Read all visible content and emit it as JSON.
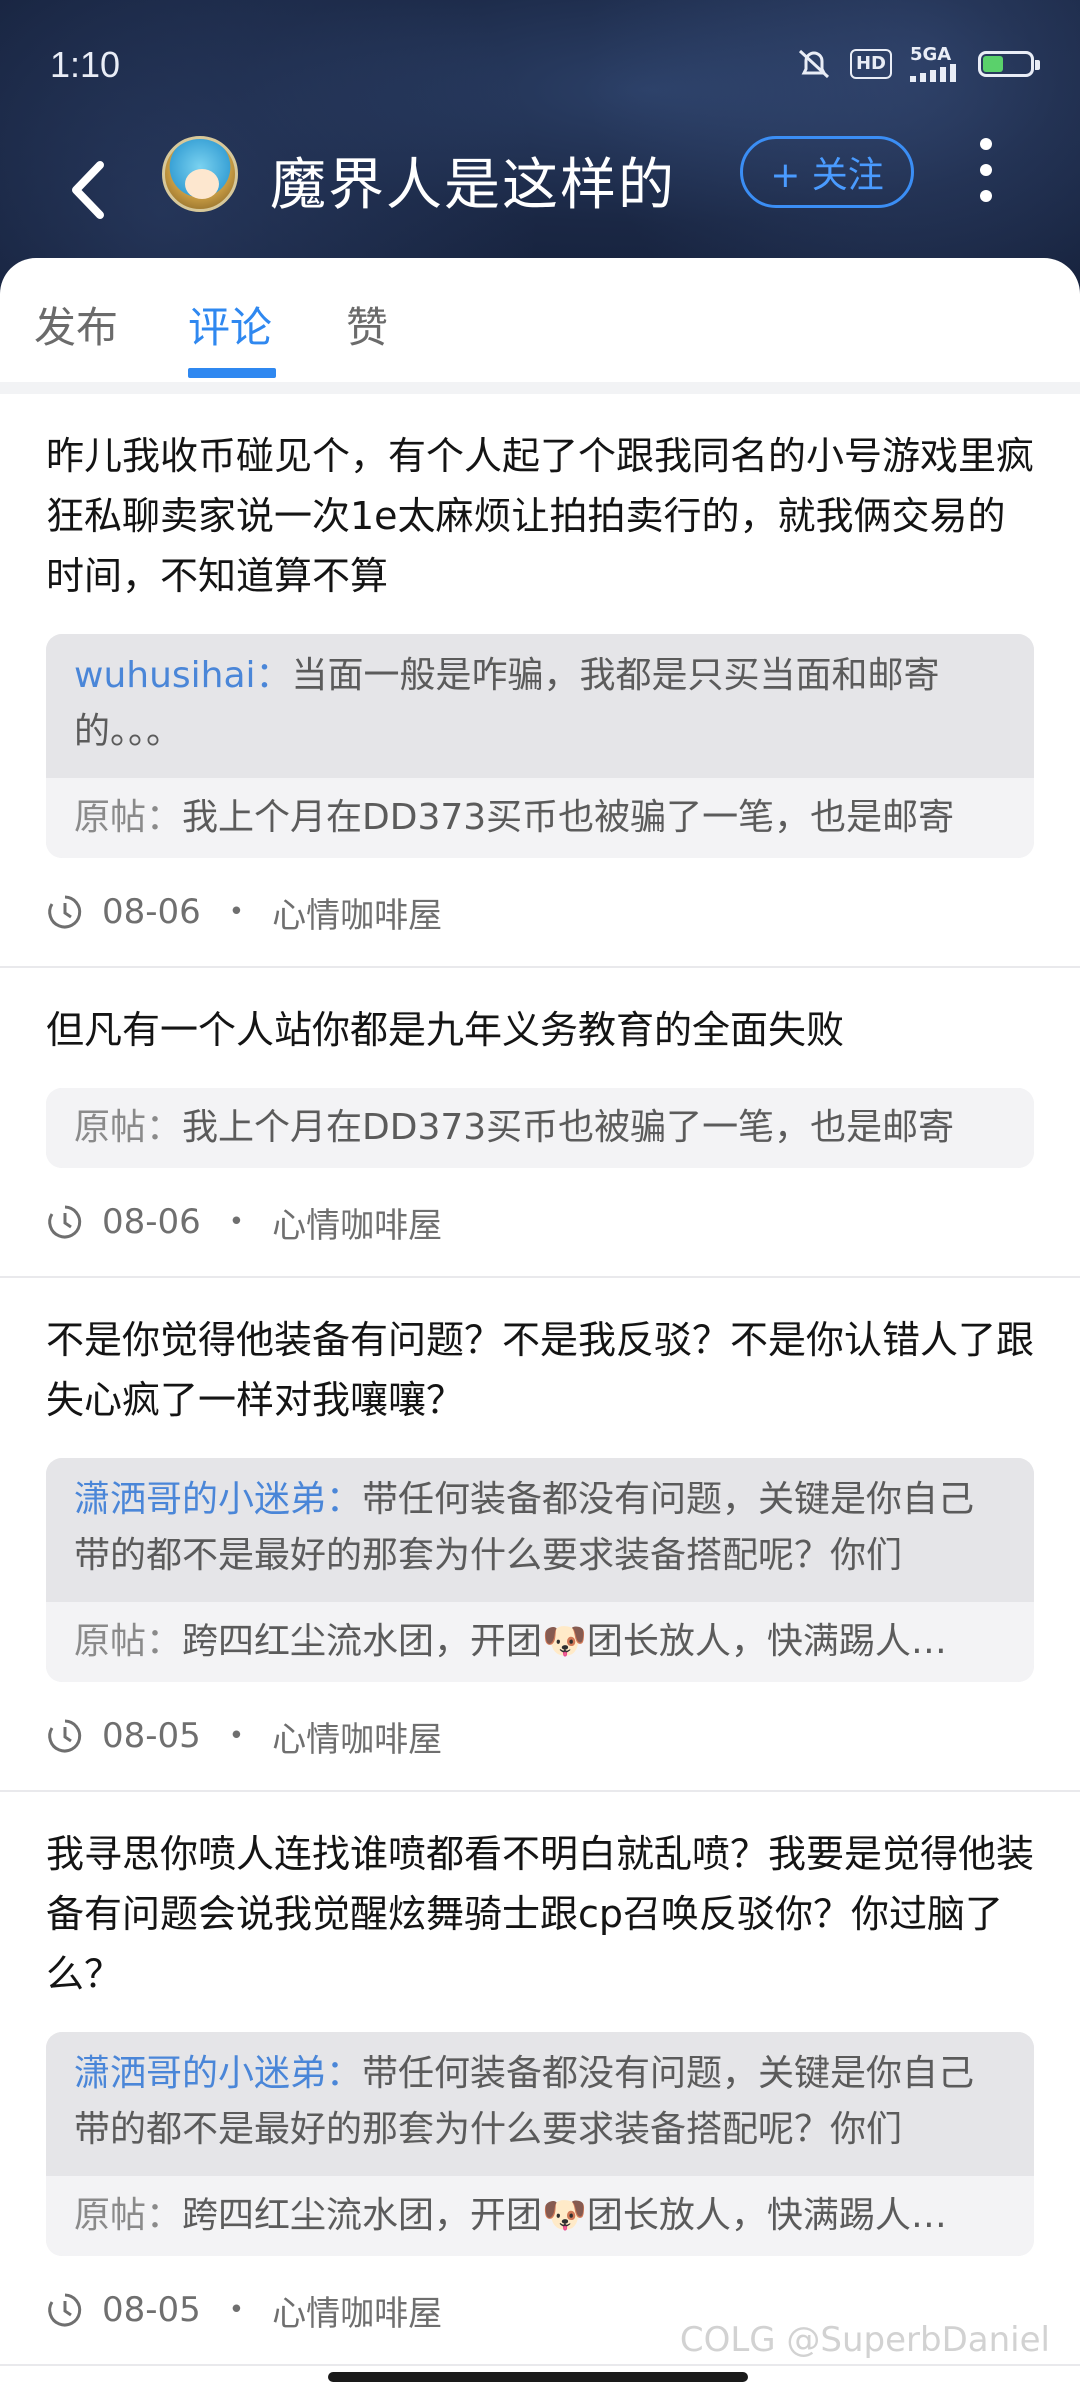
{
  "status_bar": {
    "time": "1:10",
    "network_label": "5GA",
    "hd_label": "HD"
  },
  "nav": {
    "title": "魔界人是这样的",
    "follow_label": "+ 关注"
  },
  "tabs": [
    {
      "label": "发布",
      "active": false
    },
    {
      "label": "评论",
      "active": true
    },
    {
      "label": "赞",
      "active": false
    }
  ],
  "posts": [
    {
      "text": "昨儿我收币碰见个，有个人起了个跟我同名的小号游戏里疯狂私聊卖家说一次1e太麻烦让拍拍卖行的，就我俩交易的时间，不知道算不算",
      "reply_author": "wuhusihai：",
      "reply_text": "当面一般是咋骗，我都是只买当面和邮寄的。。。",
      "orig_label": "原帖：",
      "orig_text": "我上个月在DD373买币也被骗了一笔，也是邮寄",
      "date": "08-06",
      "board": "心情咖啡屋"
    },
    {
      "text": "但凡有一个人站你都是九年义务教育的全面失败",
      "orig_label": "原帖：",
      "orig_text": "我上个月在DD373买币也被骗了一笔，也是邮寄",
      "date": "08-06",
      "board": "心情咖啡屋"
    },
    {
      "text": "不是你觉得他装备有问题？不是我反驳？不是你认错人了跟失心疯了一样对我嚷嚷？",
      "reply_author": "潇洒哥的小迷弟：",
      "reply_text": "带任何装备都没有问题，关键是你自己带的都不是最好的那套为什么要求装备搭配呢？你们",
      "orig_label": "原帖：",
      "orig_text": "跨四红尘流水团，开团🐶团长放人，快满踢人…",
      "date": "08-05",
      "board": "心情咖啡屋"
    },
    {
      "text": "我寻思你喷人连找谁喷都看不明白就乱喷？我要是觉得他装备有问题会说我觉醒炫舞骑士跟cp召唤反驳你？你过脑了么？",
      "reply_author": "潇洒哥的小迷弟：",
      "reply_text": "带任何装备都没有问题，关键是你自己带的都不是最好的那套为什么要求装备搭配呢？你们",
      "orig_label": "原帖：",
      "orig_text": "跨四红尘流水团，开团🐶团长放人，快满踢人…",
      "date": "08-05",
      "board": "心情咖啡屋"
    }
  ],
  "watermark": "COLG @SuperbDaniel",
  "colors": {
    "accent": "#2f88f0",
    "reply_author": "#4a86d8"
  }
}
